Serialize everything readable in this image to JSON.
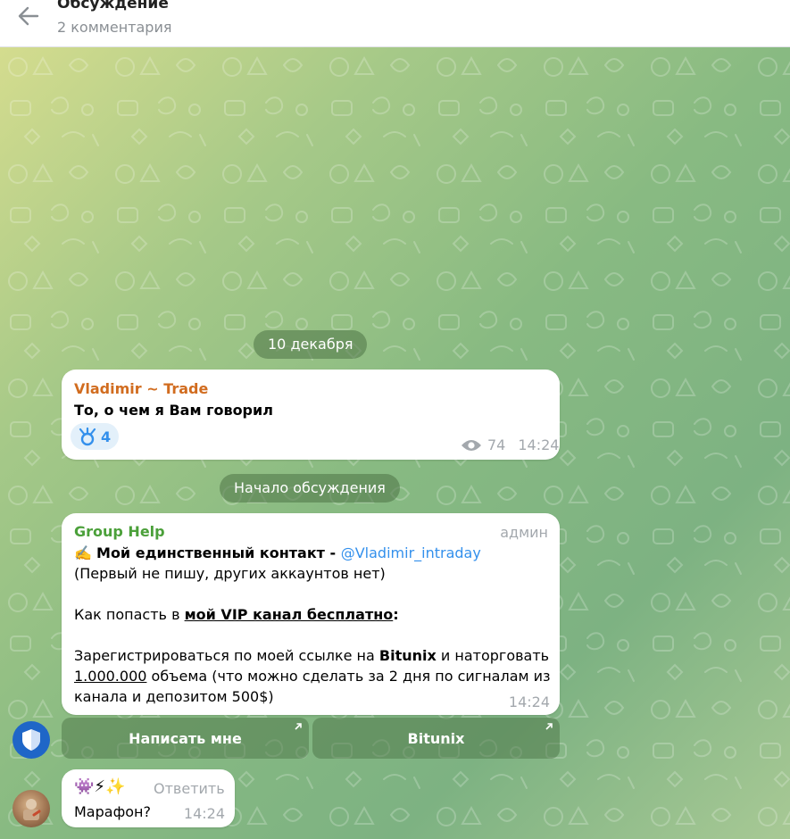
{
  "header": {
    "title": "Обсуждение",
    "subtitle": "2 комментария"
  },
  "date_separator": "10 декабря",
  "discussion_separator": "Начало обсуждения",
  "msg1": {
    "author": "Vladimir ~ Trade",
    "text": "То, о чем я Вам говорил",
    "reaction_count": "4",
    "views": "74",
    "time": "14:24"
  },
  "msg2": {
    "author": "Group Help",
    "badge": "админ",
    "line1_emoji": "✍️",
    "line1_bold": "Мой единственный контакт - ",
    "line1_mention": "@Vladimir_intraday",
    "line2": "(Первый не пишу, других аккаунтов нет)",
    "line3_prefix": "Как попасть в ",
    "line3_link": "мой VIP канал бесплатно",
    "line3_suffix": ":",
    "line4_prefix": "Зарегистрироваться по моей ссылке на ",
    "line4_bold": "Bitunix",
    "line4_suffix": " и наторговать",
    "line5_link": "1.000.000",
    "line5_suffix": " объема (что можно сделать за 2 дня по сигналам из",
    "line6": "канала и депозитом 500$)",
    "time": "14:24",
    "button1": "Написать мне",
    "button2": "Bitunix"
  },
  "msg3": {
    "emojis": "👾⚡✨",
    "reply_label": "Ответить",
    "text": "Марафон?",
    "time": "14:24"
  },
  "colors": {
    "accent": "#3390ec",
    "author_orange": "#d16c1f",
    "author_green": "#4ba03a"
  }
}
